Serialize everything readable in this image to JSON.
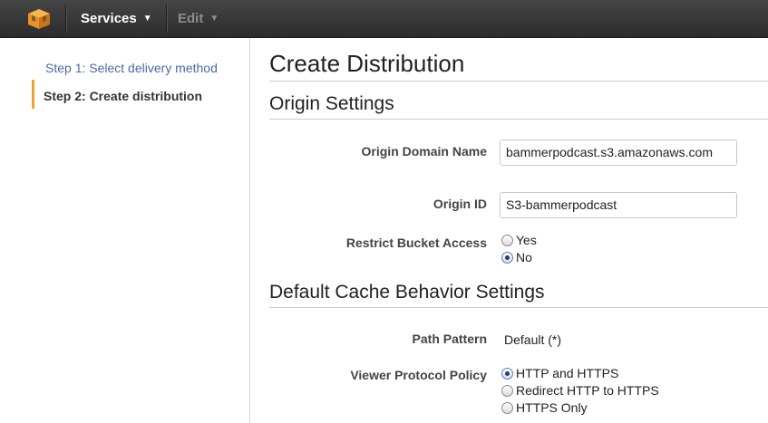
{
  "header": {
    "logo_icon": "aws-cube-icon",
    "accent_color": "#f0a22e",
    "menus": [
      {
        "label": "Services"
      },
      {
        "label": "Edit"
      }
    ]
  },
  "sidebar": {
    "steps": [
      {
        "label": "Step 1: Select delivery method",
        "active": false
      },
      {
        "label": "Step 2: Create distribution",
        "active": true
      }
    ]
  },
  "main": {
    "title": "Create Distribution",
    "origin_settings": {
      "title": "Origin Settings",
      "origin_domain_name": {
        "label": "Origin Domain Name",
        "value": "bammerpodcast.s3.amazonaws.com"
      },
      "origin_id": {
        "label": "Origin ID",
        "value": "S3-bammerpodcast"
      },
      "restrict_bucket_access": {
        "label": "Restrict Bucket Access",
        "options": [
          {
            "label": "Yes",
            "selected": false
          },
          {
            "label": "No",
            "selected": true
          }
        ]
      }
    },
    "cache_behavior": {
      "title": "Default Cache Behavior Settings",
      "path_pattern": {
        "label": "Path Pattern",
        "value": "Default (*)"
      },
      "viewer_protocol_policy": {
        "label": "Viewer Protocol Policy",
        "options": [
          {
            "label": "HTTP and HTTPS",
            "selected": true
          },
          {
            "label": "Redirect HTTP to HTTPS",
            "selected": false
          },
          {
            "label": "HTTPS Only",
            "selected": false
          }
        ]
      }
    }
  }
}
